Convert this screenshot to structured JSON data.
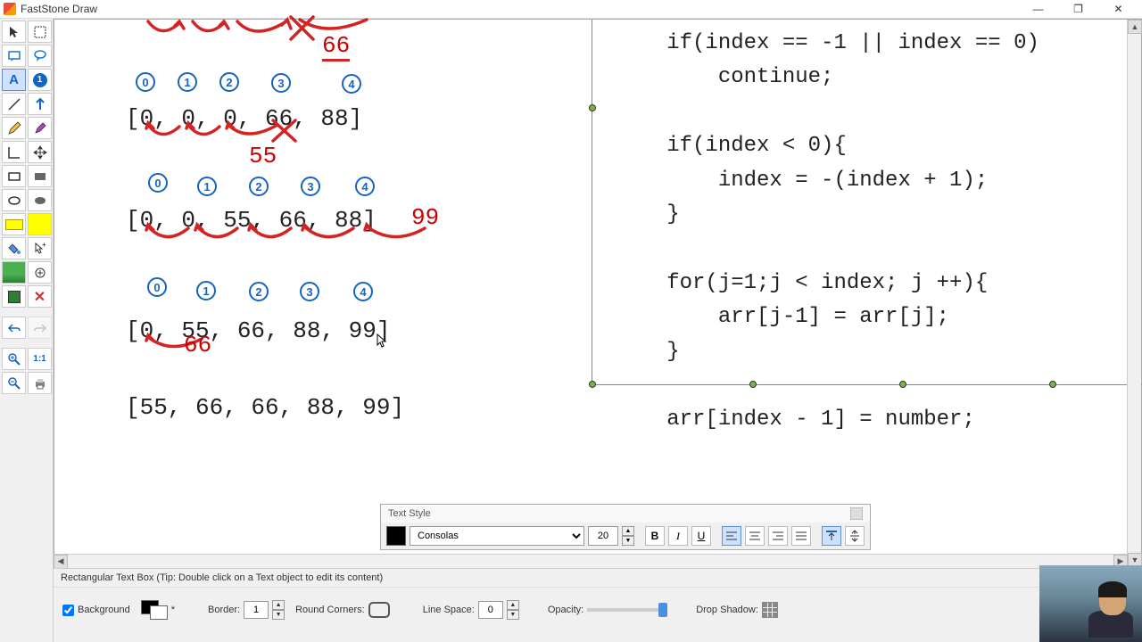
{
  "window": {
    "title": "FastStone Draw"
  },
  "code": "   if(index == -1 || index == 0)\n       continue;\n\n   if(index < 0){\n       index = -(index + 1);\n   }\n\n   for(j=1;j < index; j ++){\n       arr[j-1] = arr[j];\n   }\n\n   arr[index - 1] = number;\n\n\n}",
  "annotations": {
    "top_66": "66",
    "mid_55": "55",
    "right_99": "99",
    "low_66": "66"
  },
  "arrays": {
    "line1": "[0, 0, 0, 66, 88]",
    "line2": "[0, 0, 55, 66, 88]",
    "line3": "[0, 55, 66, 88, 99]",
    "line4": "[55, 66, 66, 88, 99]"
  },
  "badges": [
    "0",
    "1",
    "2",
    "3",
    "4"
  ],
  "textStyle": {
    "title": "Text Style",
    "font": "Consolas",
    "size": "20"
  },
  "status": {
    "hint": "Rectangular Text Box (Tip: Double click on a Text object to edit its content)",
    "bg_label": "Background",
    "star": "*",
    "border_label": "Border:",
    "border_val": "1",
    "round_label": "Round Corners:",
    "line_label": "Line Space:",
    "line_val": "0",
    "opacity_label": "Opacity:",
    "shadow_label": "Drop Shadow:"
  }
}
